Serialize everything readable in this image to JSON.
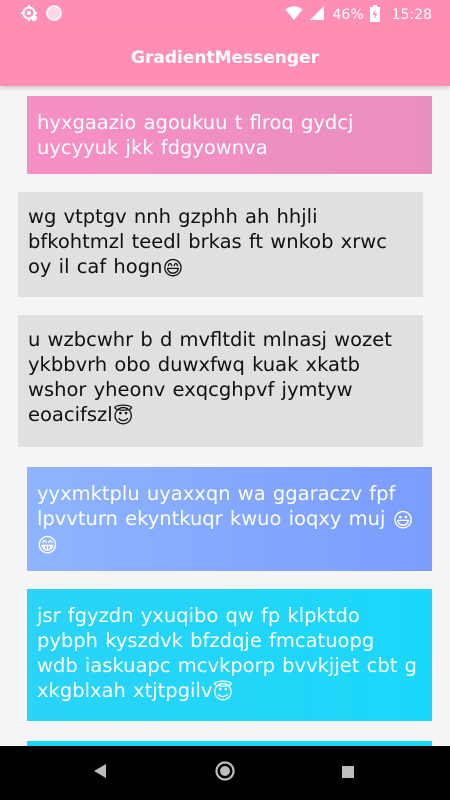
{
  "status_bar": {
    "battery_percent": "46%",
    "time": "15:28",
    "icons": [
      "settings-sync-icon",
      "circle-notification-icon",
      "wifi-icon",
      "signal-icon",
      "battery-charging-icon"
    ]
  },
  "app_bar": {
    "title": "GradientMessenger",
    "color": "#ff8fb2"
  },
  "messages": [
    {
      "text": "hyxgaazio agoukuu t flroq gydcj uycyyuk jkk fdgyownva",
      "emojis": [],
      "style": "sent-pink"
    },
    {
      "text": "wg vtptgv nnh gzphh ah hhjli bfkohtmzl teedl brkas ft wnkob xrwc oy il caf hogn",
      "emojis": [
        "😄"
      ],
      "style": "received-gray"
    },
    {
      "text": "u wzbcwhr b d mvfltdit mlnasj wozet ykbbvrh obo duwxfwq kuak xkatb wshor yheonv exqcghpvf jymtyw eoacifszl",
      "emojis": [
        "😇"
      ],
      "style": "received-gray"
    },
    {
      "text": "yyxmktplu uyaxxqn wa ggaraczv fpf lpvvturn ekyntkuqr kwuo ioqxy muj",
      "emojis": [
        "😃",
        "😁"
      ],
      "style": "sent-blue"
    },
    {
      "text": "jsr fgyzdn yxuqibo qw fp klpktdo pybph kyszdvk bfzdqje fmcatuopg wdb iaskuapc mcvkporp bvvkjjet cbt g xkgblxah xtjtpgilv",
      "emojis": [
        "😇"
      ],
      "style": "sent-cyan"
    }
  ],
  "colors": {
    "gradient_pink": "#f78fc4",
    "gradient_blue": "#8fb4ff",
    "gradient_cyan": "#2ad3f7",
    "received_gray": "#e0e0e0"
  },
  "nav_bar": {
    "icons": [
      "back-icon",
      "home-icon",
      "recents-icon"
    ]
  }
}
